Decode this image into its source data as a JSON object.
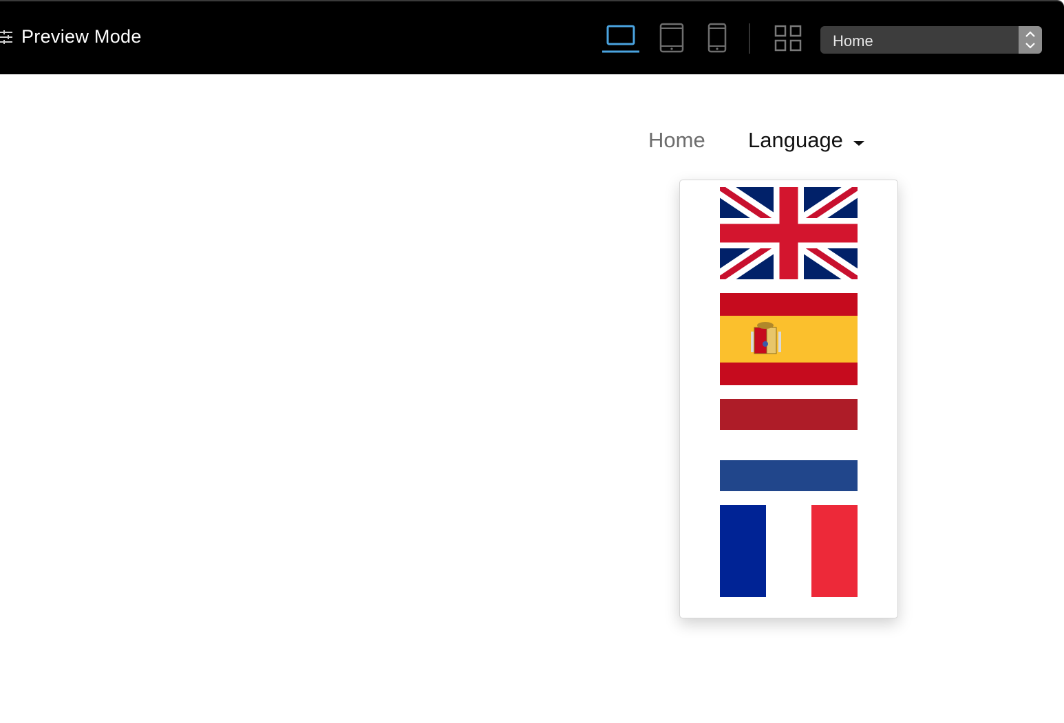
{
  "toolbar": {
    "title": "Preview Mode",
    "device_buttons": [
      {
        "name": "desktop",
        "icon": "laptop-icon",
        "active": true
      },
      {
        "name": "tablet",
        "icon": "tablet-icon",
        "active": false
      },
      {
        "name": "phone",
        "icon": "phone-icon",
        "active": false
      }
    ],
    "grid_icon": "grid-icon",
    "page_select": {
      "value": "Home"
    }
  },
  "nav": {
    "home_label": "Home",
    "language_label": "Language"
  },
  "language_menu": {
    "items": [
      {
        "icon": "uk-flag-icon"
      },
      {
        "icon": "spain-flag-icon"
      },
      {
        "icon": "netherlands-flag-icon"
      },
      {
        "icon": "france-flag-icon"
      }
    ]
  },
  "colors": {
    "toolbar_bg": "#000000",
    "active_device": "#4aa3df",
    "inactive_device": "#6e6e6e",
    "select_bg": "#3d3d3d",
    "nav_home": "#6d6d6d",
    "nav_language": "#111111"
  }
}
